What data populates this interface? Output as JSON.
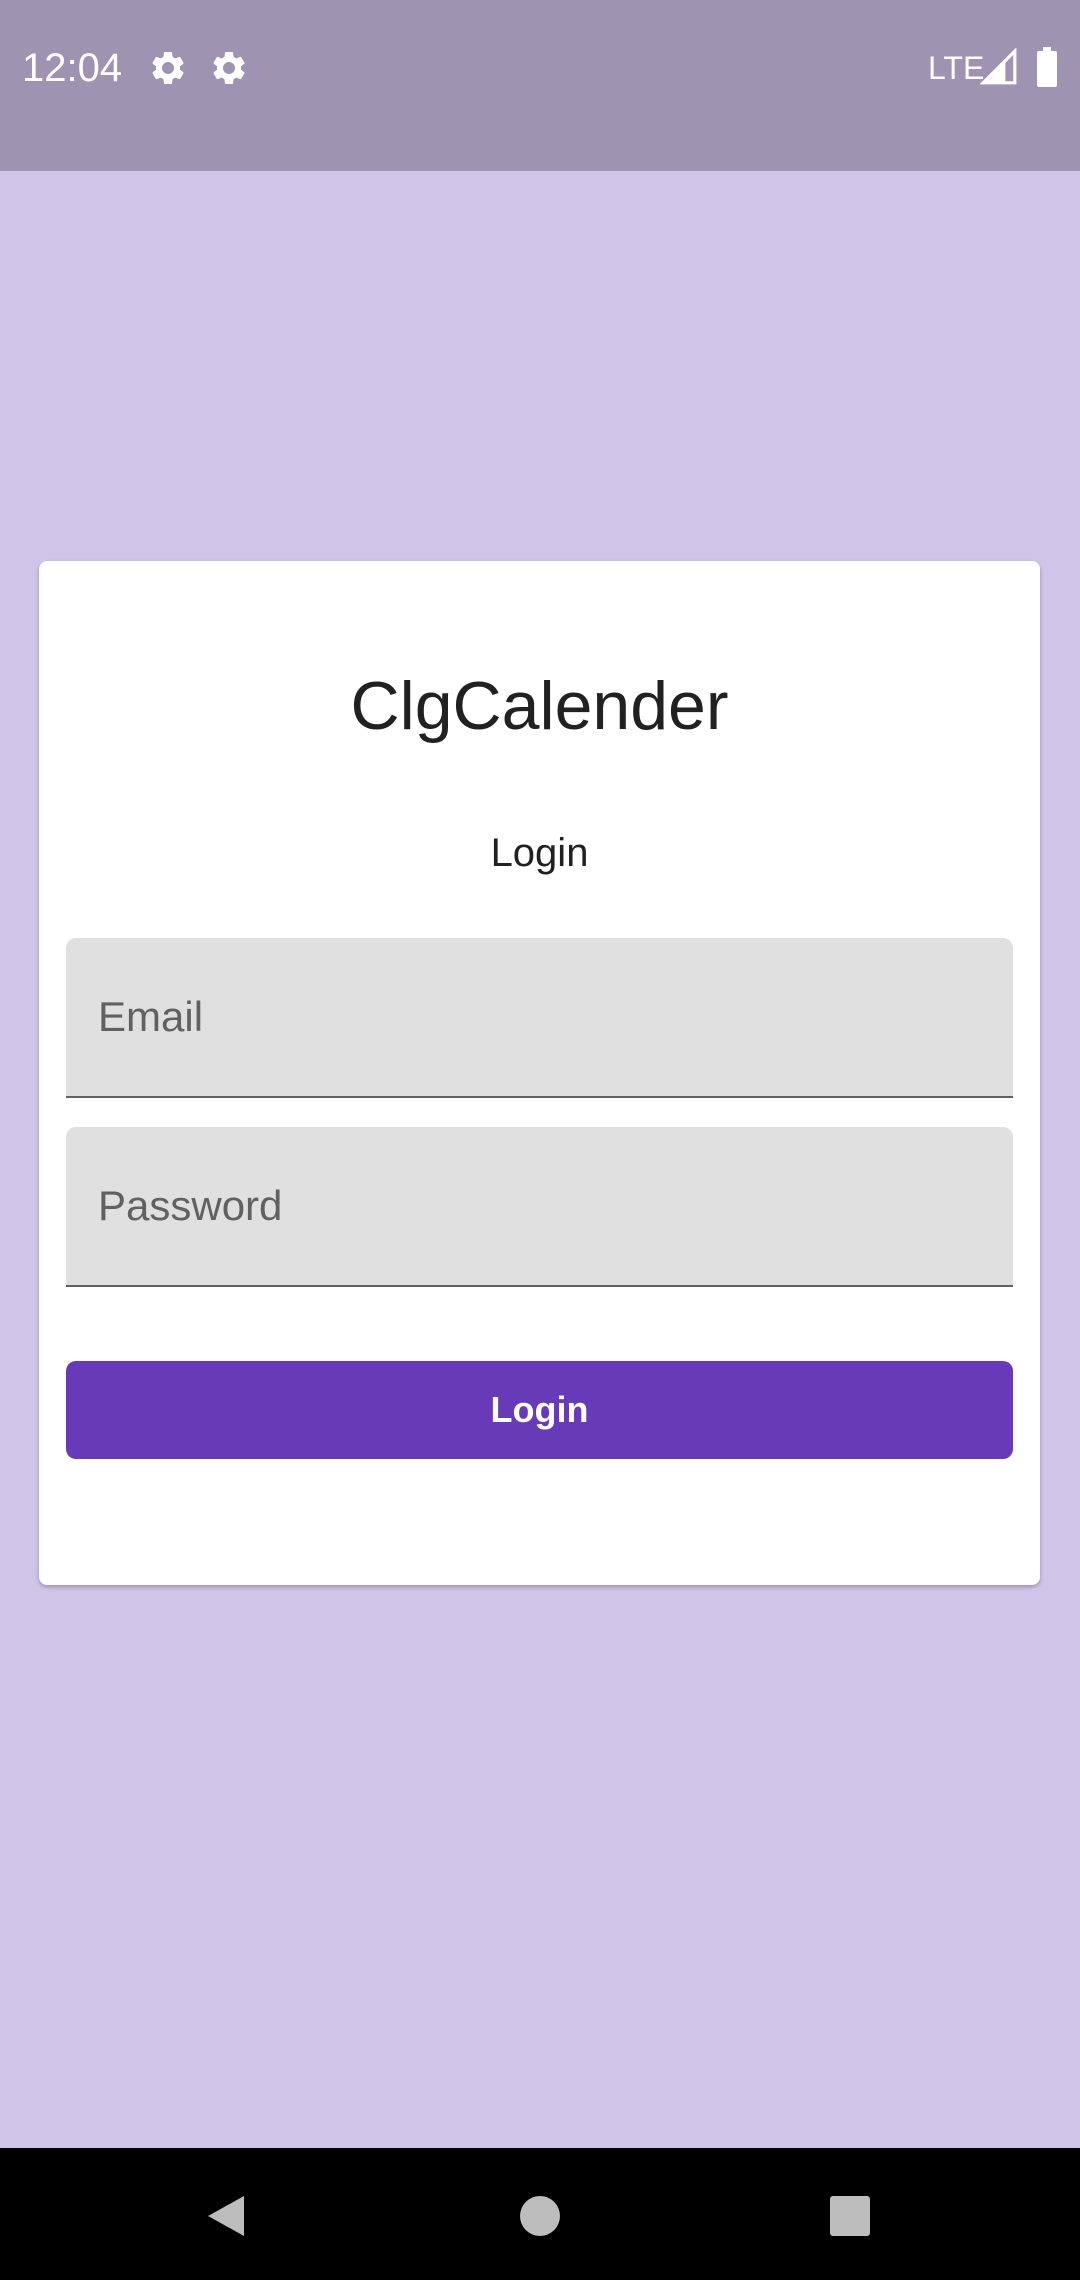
{
  "status_bar": {
    "time": "12:04",
    "network": "LTE",
    "icons": [
      "settings-icon",
      "settings-icon",
      "signal-icon",
      "battery-icon"
    ]
  },
  "login_card": {
    "app_title": "ClgCalender",
    "subtitle": "Login",
    "email_placeholder": "Email",
    "email_value": "",
    "password_placeholder": "Password",
    "password_value": "",
    "login_button_label": "Login"
  },
  "navigation_bar": {
    "icons": [
      "back-icon",
      "home-icon",
      "recents-icon"
    ]
  },
  "colors": {
    "background": "#d1c4e9",
    "status_bar": "#9e94b2",
    "card": "#ffffff",
    "field": "#e0e0e0",
    "accent": "#673ab7",
    "nav_bar": "#000000"
  }
}
